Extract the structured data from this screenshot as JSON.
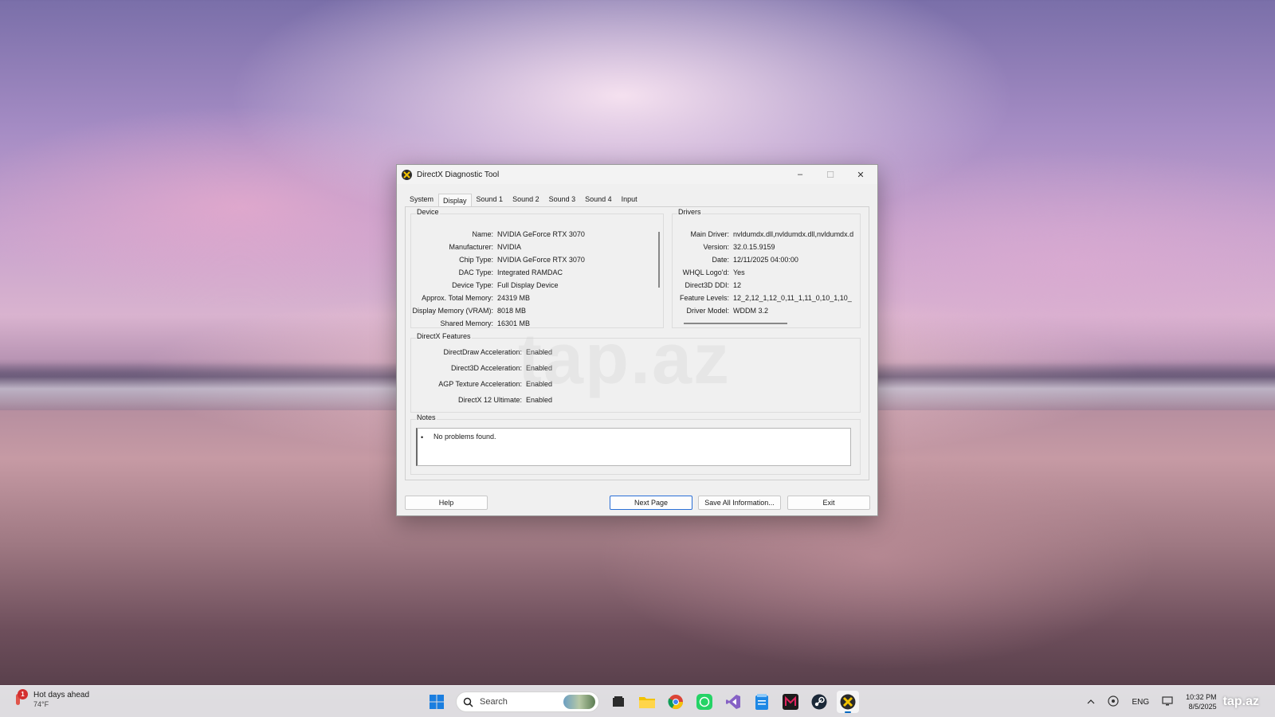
{
  "window": {
    "title": "DirectX Diagnostic Tool",
    "minimize": "–",
    "maximize": "☐",
    "close": "✕"
  },
  "tabs": [
    {
      "label": "System"
    },
    {
      "label": "Display",
      "active": true
    },
    {
      "label": "Sound 1"
    },
    {
      "label": "Sound 2"
    },
    {
      "label": "Sound 3"
    },
    {
      "label": "Sound 4"
    },
    {
      "label": "Input"
    }
  ],
  "device": {
    "label": "Device",
    "rows": [
      {
        "key": "Name:",
        "value": "NVIDIA GeForce RTX 3070"
      },
      {
        "key": "Manufacturer:",
        "value": "NVIDIA"
      },
      {
        "key": "Chip Type:",
        "value": "NVIDIA GeForce RTX 3070"
      },
      {
        "key": "DAC Type:",
        "value": "Integrated RAMDAC"
      },
      {
        "key": "Device Type:",
        "value": "Full Display Device"
      },
      {
        "key": "Approx. Total Memory:",
        "value": "24319 MB"
      },
      {
        "key": "Display Memory (VRAM):",
        "value": "8018 MB"
      },
      {
        "key": "Shared Memory:",
        "value": "16301 MB"
      }
    ]
  },
  "drivers": {
    "label": "Drivers",
    "rows": [
      {
        "key": "Main Driver:",
        "value": "nvldumdx.dll,nvldumdx.dll,nvldumdx.d"
      },
      {
        "key": "Version:",
        "value": "32.0.15.9159"
      },
      {
        "key": "Date:",
        "value": "12/11/2025 04:00:00"
      },
      {
        "key": "WHQL Logo'd:",
        "value": "Yes"
      },
      {
        "key": "Direct3D DDI:",
        "value": "12"
      },
      {
        "key": "Feature Levels:",
        "value": "12_2,12_1,12_0,11_1,11_0,10_1,10_"
      },
      {
        "key": "Driver Model:",
        "value": "WDDM 3.2"
      }
    ]
  },
  "features": {
    "label": "DirectX Features",
    "rows": [
      {
        "key": "DirectDraw Acceleration:",
        "value": "Enabled"
      },
      {
        "key": "Direct3D Acceleration:",
        "value": "Enabled"
      },
      {
        "key": "AGP Texture Acceleration:",
        "value": "Enabled"
      },
      {
        "key": "DirectX 12 Ultimate:",
        "value": "Enabled"
      }
    ]
  },
  "notes": {
    "label": "Notes",
    "bullet": "•",
    "text": "No problems found."
  },
  "buttons": {
    "help": "Help",
    "next": "Next Page",
    "save": "Save All Information...",
    "exit": "Exit"
  },
  "watermark": "tap.az",
  "taskbar": {
    "weather_badge": "1",
    "weather_title": "Hot days ahead",
    "weather_temp": "74°F",
    "search_placeholder": "Search",
    "tray_lang": "ENG",
    "clock_time": "10:32 PM",
    "clock_date": "8/5/2025",
    "watermark": "tap.az"
  },
  "colors": {
    "accent": "#0067c0",
    "default_button_border": "#2a6fd6"
  }
}
